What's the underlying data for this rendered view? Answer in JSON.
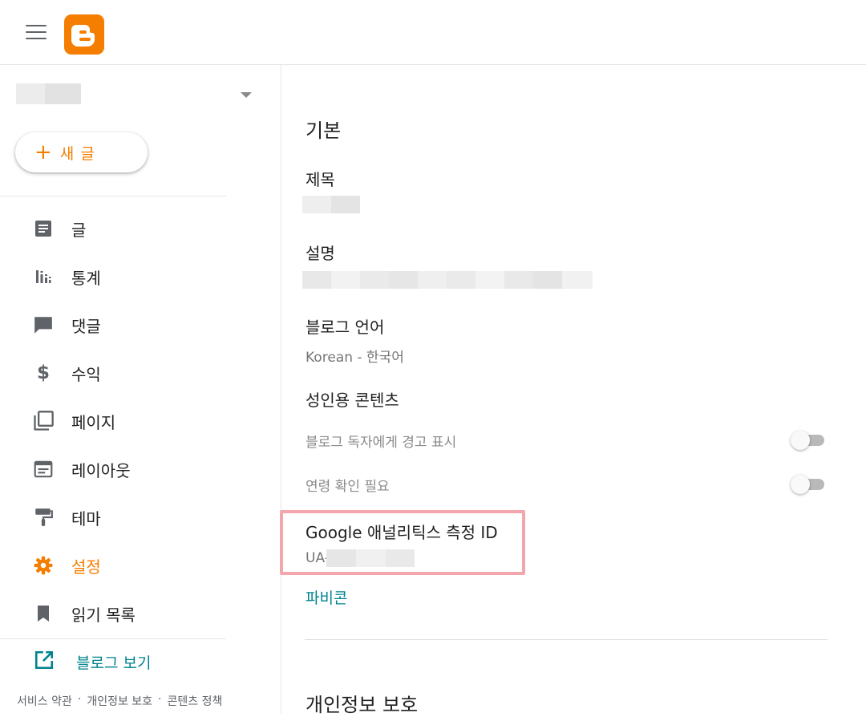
{
  "app": {
    "logo": "blogger-logo",
    "menu_icon": "hamburger-menu-icon"
  },
  "sidebar": {
    "blog_selector": {
      "value": "",
      "icon": "caret-down-icon"
    },
    "new_post": {
      "plus": "+",
      "label": "새 글"
    },
    "items": [
      {
        "label": "글",
        "icon": "posts-icon"
      },
      {
        "label": "통계",
        "icon": "stats-icon"
      },
      {
        "label": "댓글",
        "icon": "comment-icon"
      },
      {
        "label": "수익",
        "icon": "dollar-icon"
      },
      {
        "label": "페이지",
        "icon": "pages-icon"
      },
      {
        "label": "레이아웃",
        "icon": "layout-icon"
      },
      {
        "label": "테마",
        "icon": "theme-icon"
      },
      {
        "label": "설정",
        "icon": "gear-icon",
        "active": true
      },
      {
        "label": "읽기 목록",
        "icon": "bookmark-icon"
      }
    ],
    "view_blog": {
      "label": "블로그 보기",
      "icon": "open-external-icon"
    },
    "footer": {
      "terms": "서비스 약관",
      "privacy": "개인정보 보호",
      "content_policy": "콘텐츠 정책",
      "separator": "·"
    }
  },
  "main": {
    "basic_section": "기본",
    "title_label": "제목",
    "description_label": "설명",
    "language_label": "블로그 언어",
    "language_value": "Korean - 한국어",
    "adult_label": "성인용 콘텐츠",
    "adult_warning_label": "블로그 독자에게 경고 표시",
    "age_check_label": "연령 확인 필요",
    "analytics_label": "Google 애널리틱스 측정 ID",
    "analytics_value": "UA-",
    "favicon_label": "파비콘",
    "privacy_section": "개인정보 보호"
  },
  "colors": {
    "accent": "#f57d00",
    "link": "#00838f",
    "highlight": "#f3a6ad"
  }
}
